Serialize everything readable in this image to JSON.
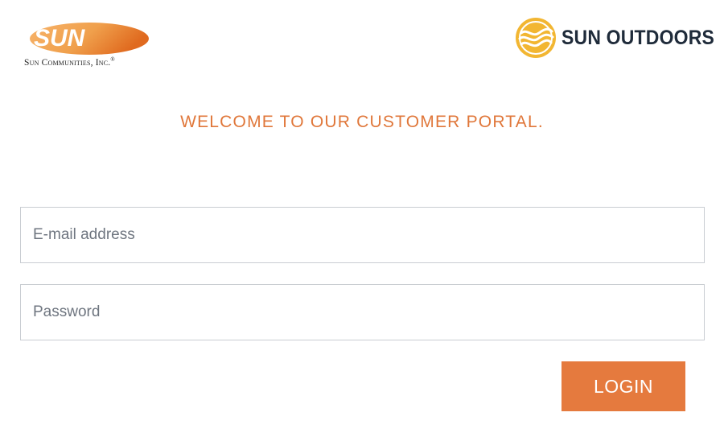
{
  "header": {
    "left_logo": {
      "wordmark": "SUN",
      "subtitle": "Sun Communities, Inc.",
      "registered_mark": "®",
      "gradient_start": "#f7b36a",
      "gradient_end": "#e06a1f"
    },
    "right_logo": {
      "icon": "sun-outdoors-emblem-icon",
      "text": "SUN OUTDOORS",
      "emblem_color": "#f2b632",
      "text_color": "#1f2b3a"
    }
  },
  "main": {
    "welcome_text": "WELCOME TO OUR CUSTOMER PORTAL.",
    "email_placeholder": "E-mail address",
    "email_value": "",
    "password_placeholder": "Password",
    "password_value": "",
    "login_label": "LOGIN"
  },
  "colors": {
    "accent": "#e57a3e",
    "welcome_text": "#e0773a",
    "input_border": "#c9cdd2"
  }
}
